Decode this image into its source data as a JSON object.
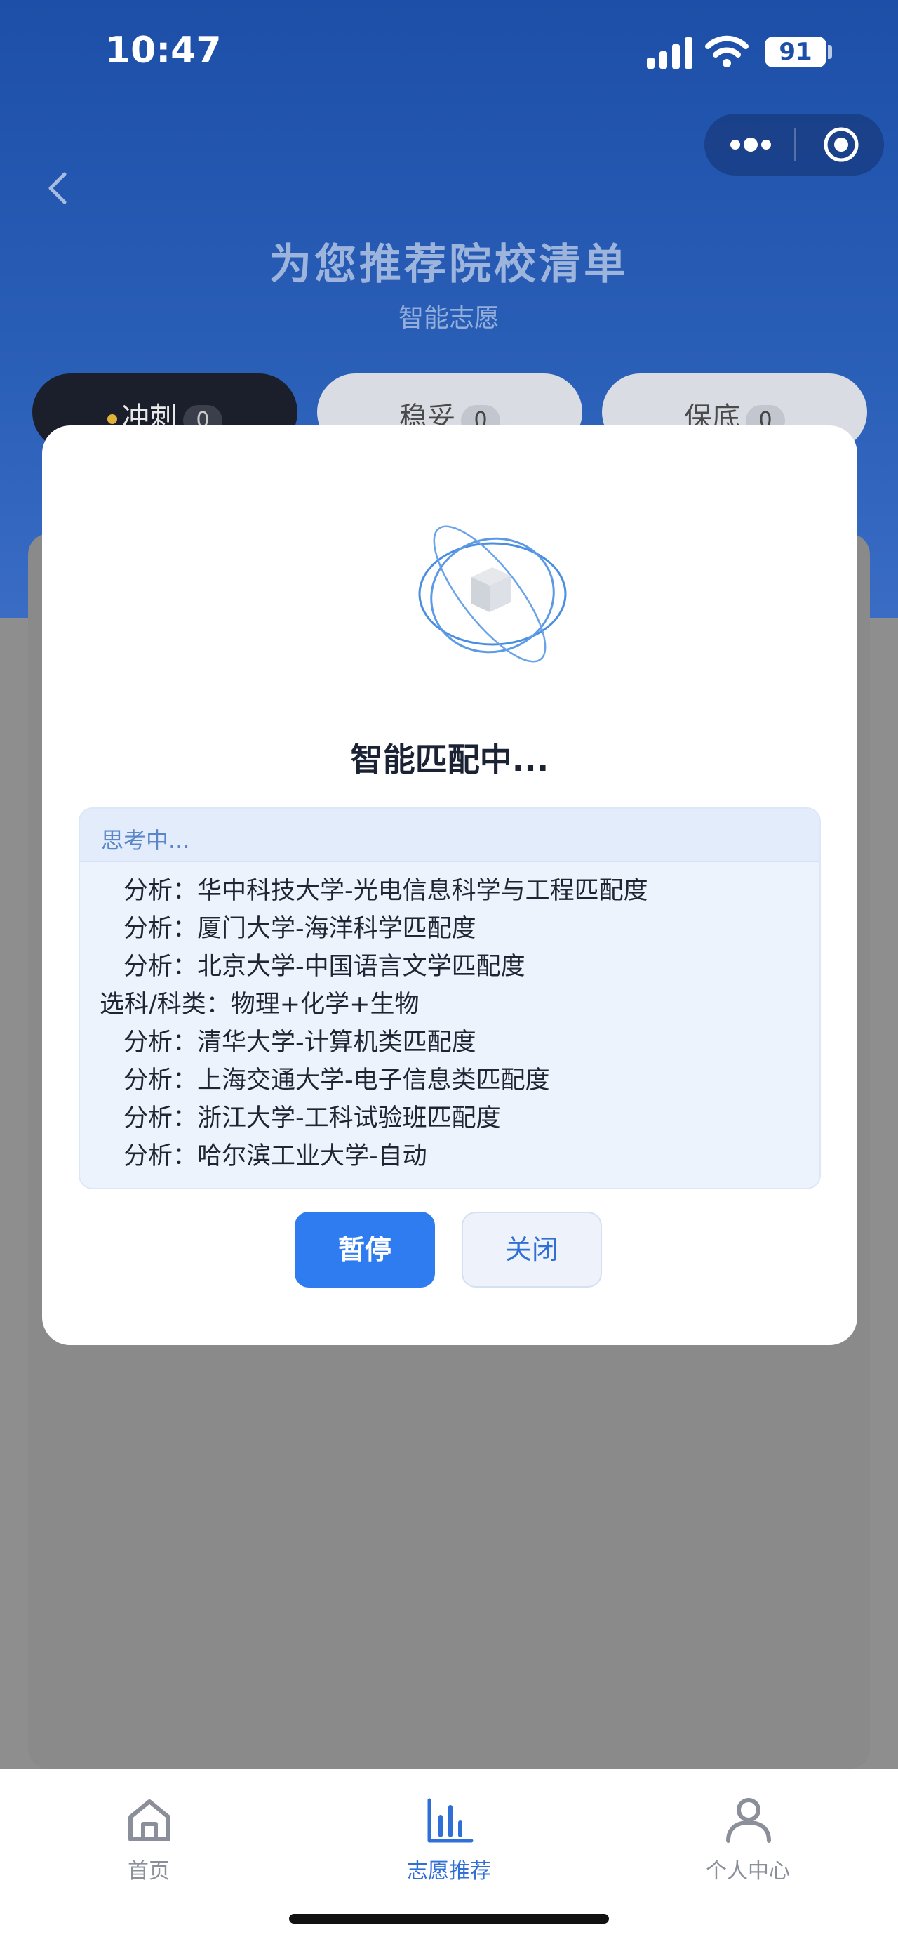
{
  "status_bar": {
    "time": "10:47",
    "battery": "91"
  },
  "header": {
    "title": "为您推荐院校清单",
    "subtitle": "智能志愿"
  },
  "tabs": [
    {
      "label": "冲刺",
      "count": "0",
      "active": true
    },
    {
      "label": "稳妥",
      "count": "0",
      "active": false
    },
    {
      "label": "保底",
      "count": "0",
      "active": false
    }
  ],
  "modal": {
    "title": "智能匹配中...",
    "thinking_label": "思考中...",
    "lines": [
      "分析：华中科技大学-光电信息科学与工程匹配度",
      "分析：厦门大学-海洋科学匹配度",
      "分析：北京大学-中国语言文学匹配度",
      "选科/科类：物理+化学+生物",
      "分析：清华大学-计算机类匹配度",
      "分析：上海交通大学-电子信息类匹配度",
      "分析：浙江大学-工科试验班匹配度",
      "分析：哈尔滨工业大学-自动"
    ],
    "pause_label": "暂停",
    "close_label": "关闭"
  },
  "bottom_nav": [
    {
      "label": "首页",
      "icon": "home-icon",
      "active": false
    },
    {
      "label": "志愿推荐",
      "icon": "bar-chart-icon",
      "active": true
    },
    {
      "label": "个人中心",
      "icon": "user-icon",
      "active": false
    }
  ],
  "colors": {
    "brand_blue": "#2f7cf0",
    "header_blue": "#1d4fa8",
    "tab_dot": "#e0b23a"
  }
}
